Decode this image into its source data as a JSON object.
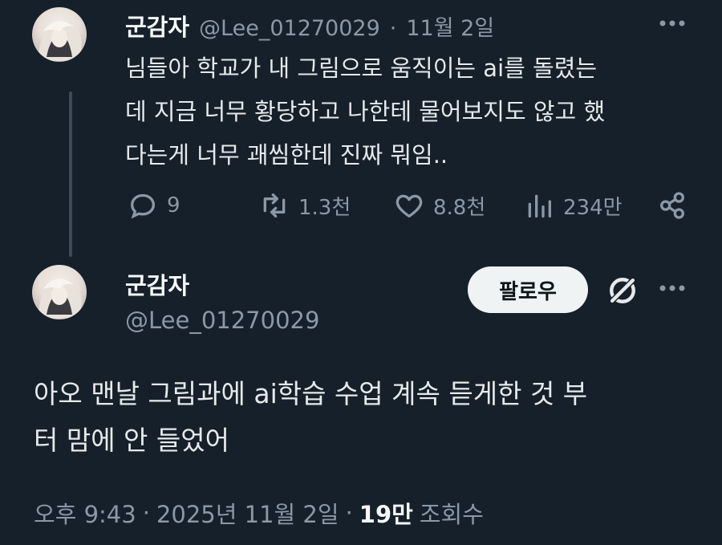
{
  "reply_tweet": {
    "display_name": "군감자",
    "handle": "@Lee_01270029",
    "separator": "·",
    "date": "11월 2일",
    "more_icon": "more-horizontal-icon",
    "text_lines": [
      "님들아 학교가 내 그림으로 움직이는 ai를 돌렸는",
      "데 지금 너무 황당하고 나한테 물어보지도 않고 했",
      "다는게 너무 괘씸한데 진짜 뭐임.."
    ],
    "actions": {
      "replies": "9",
      "reposts": "1.3천",
      "likes": "8.8천",
      "views": "234만"
    }
  },
  "main_tweet": {
    "display_name": "군감자",
    "handle": "@Lee_01270029",
    "follow_label": "팔로우",
    "text_lines": [
      "아오 맨날 그림과에 ai학습 수업 계속 듣게한 것 부",
      "터 맘에 안 들었어"
    ],
    "time": "오후 9:43",
    "separator": "·",
    "date": "2025년 11월 2일",
    "views_count": "19만",
    "views_label": "조회수"
  },
  "colors": {
    "background": "#15202b",
    "text": "#e7e9ea",
    "muted": "#8b98a5",
    "follow_bg": "#eff3f4"
  }
}
